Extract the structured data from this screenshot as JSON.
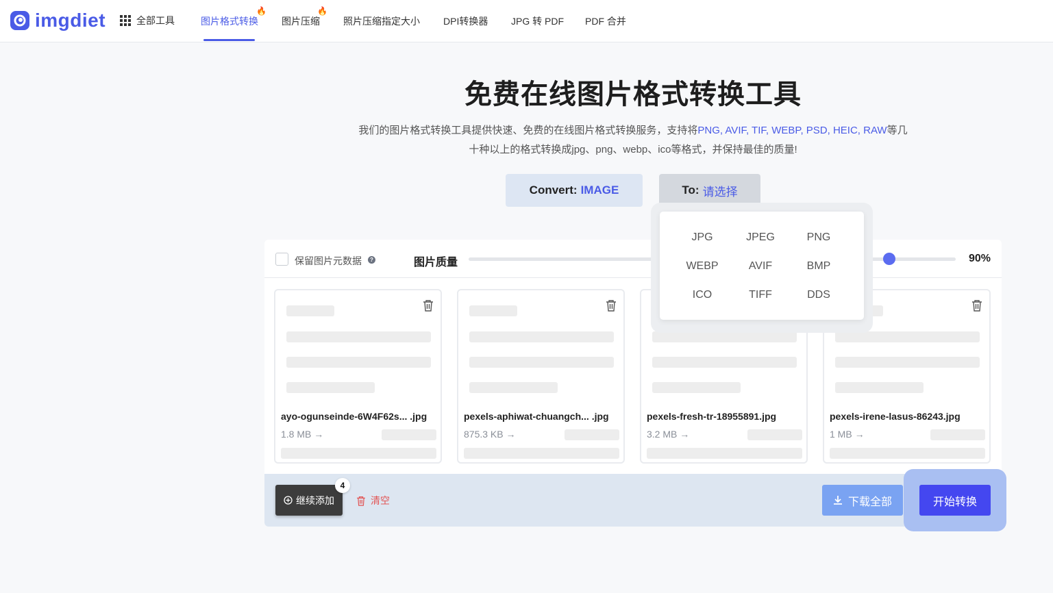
{
  "header": {
    "logo_text": "imgdiet",
    "all_tools": "全部工具",
    "nav": [
      {
        "label": "图片格式转换",
        "active": true,
        "hot": true
      },
      {
        "label": "图片压缩",
        "active": false,
        "hot": true
      },
      {
        "label": "照片压缩指定大小",
        "active": false,
        "hot": false
      },
      {
        "label": "DPI转换器",
        "active": false,
        "hot": false
      },
      {
        "label": "JPG 转 PDF",
        "active": false,
        "hot": false
      },
      {
        "label": "PDF 合并",
        "active": false,
        "hot": false
      }
    ],
    "hot_icon": "fire-icon"
  },
  "hero": {
    "title": "免费在线图片格式转换工具",
    "desc_part1": "我们的图片格式转换工具提供快速、免费的在线图片格式转换服务，支持将",
    "desc_formats": "PNG, AVIF, TIF, WEBP, PSD, HEIC, RAW",
    "desc_part2": "等几",
    "desc_line2": "十种以上的格式转换成jpg、png、webp、ico等格式，并保持最佳的质量!"
  },
  "convert": {
    "from_label": "Convert:",
    "from_value": "IMAGE",
    "to_label": "To:",
    "to_value": "请选择"
  },
  "dropdown": {
    "formats": [
      "JPG",
      "JPEG",
      "PNG",
      "WEBP",
      "AVIF",
      "BMP",
      "ICO",
      "TIFF",
      "DDS"
    ]
  },
  "options": {
    "keep_metadata": "保留图片元数据",
    "keep_metadata_checked": false,
    "quality_label": "图片质量",
    "quality_value": 90,
    "quality_text": "90%"
  },
  "files": [
    {
      "name": "ayo-ogunseinde-6W4F62s... .jpg",
      "size": "1.8 MB",
      "arrow": "→"
    },
    {
      "name": "pexels-aphiwat-chuangch... .jpg",
      "size": "875.3 KB",
      "arrow": "→"
    },
    {
      "name": "pexels-fresh-tr-18955891.jpg",
      "size": "3.2 MB",
      "arrow": "→"
    },
    {
      "name": "pexels-irene-lasus-86243.jpg",
      "size": "1 MB",
      "arrow": "→"
    }
  ],
  "actions": {
    "add_more": "继续添加",
    "file_count": "4",
    "clear": "清空",
    "download_all": "下载全部",
    "start": "开始转换"
  },
  "colors": {
    "accent": "#4a5be6",
    "start_button": "#4447f0",
    "download_button": "#7aa3f2",
    "clear_text": "#e25555"
  }
}
